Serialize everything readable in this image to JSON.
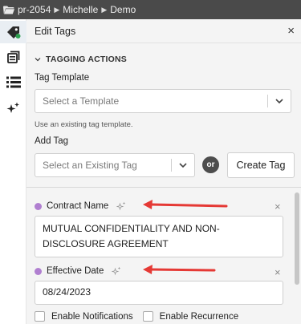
{
  "breadcrumb": {
    "items": [
      "pr-2054",
      "Michelle",
      "Demo"
    ],
    "separator": "▶"
  },
  "rail": {
    "icons": [
      "tag-icon",
      "documents-icon",
      "list-icon",
      "sparkle-icon"
    ]
  },
  "panel": {
    "title": "Edit Tags",
    "close": "×",
    "section_title": "TAGGING ACTIONS",
    "tag_template": {
      "label": "Tag Template",
      "placeholder": "Select a Template",
      "helper": "Use an existing tag template."
    },
    "add_tag": {
      "label": "Add Tag",
      "placeholder": "Select an Existing Tag",
      "or": "or",
      "create_button": "Create Tag"
    },
    "fields": [
      {
        "name": "Contract Name",
        "value": "MUTUAL CONFIDENTIALITY AND NON-DISCLOSURE AGREEMENT",
        "dot_color": "#b07fd0"
      },
      {
        "name": "Effective Date",
        "value": "08/24/2023",
        "dot_color": "#b07fd0"
      }
    ],
    "remove": "×",
    "checkboxes": [
      "Enable Notifications",
      "Enable Recurrence"
    ]
  },
  "colors": {
    "topbar": "#4a4a4a",
    "panel_bg": "#f4f4f4",
    "annotation_arrow": "#e53935",
    "tag_dot": "#b07fd0"
  }
}
